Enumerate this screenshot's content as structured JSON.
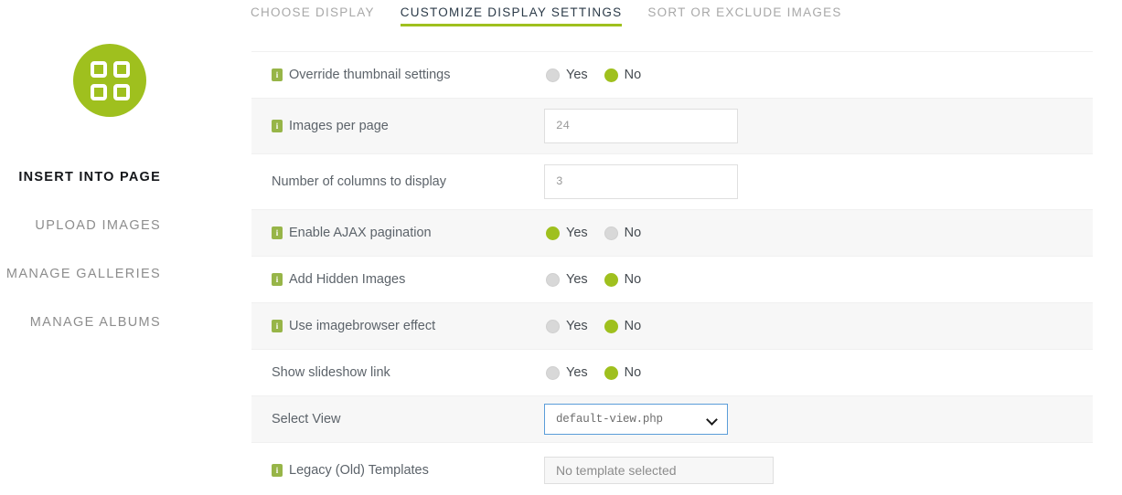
{
  "sidebar": {
    "logo_icon": "grid-four-squares-icon",
    "brand_color": "#9fc01e",
    "items": [
      {
        "label": "INSERT INTO PAGE",
        "active": true
      },
      {
        "label": "UPLOAD IMAGES",
        "active": false
      },
      {
        "label": "MANAGE GALLERIES",
        "active": false
      },
      {
        "label": "MANAGE ALBUMS",
        "active": false
      }
    ]
  },
  "tabs": [
    {
      "label": "CHOOSE DISPLAY",
      "active": false
    },
    {
      "label": "CUSTOMIZE DISPLAY SETTINGS",
      "active": true
    },
    {
      "label": "SORT OR EXCLUDE IMAGES",
      "active": false
    }
  ],
  "settings": {
    "radio_yes": "Yes",
    "radio_no": "No",
    "info_icon_glyph": "i",
    "rows": [
      {
        "label": "Override thumbnail settings",
        "has_info": true,
        "type": "radio",
        "selected": "No"
      },
      {
        "label": "Images per page",
        "has_info": true,
        "type": "input",
        "value": "24"
      },
      {
        "label": "Number of columns to display",
        "has_info": false,
        "type": "input",
        "value": "3"
      },
      {
        "label": "Enable AJAX pagination",
        "has_info": true,
        "type": "radio",
        "selected": "Yes"
      },
      {
        "label": "Add Hidden Images",
        "has_info": true,
        "type": "radio",
        "selected": "No"
      },
      {
        "label": "Use imagebrowser effect",
        "has_info": true,
        "type": "radio",
        "selected": "No"
      },
      {
        "label": "Show slideshow link",
        "has_info": false,
        "type": "radio",
        "selected": "No"
      },
      {
        "label": "Select View",
        "has_info": false,
        "type": "select",
        "value": "default-view.php"
      },
      {
        "label": "Legacy (Old) Templates",
        "has_info": true,
        "type": "input-wide",
        "value": "No template selected"
      }
    ]
  }
}
